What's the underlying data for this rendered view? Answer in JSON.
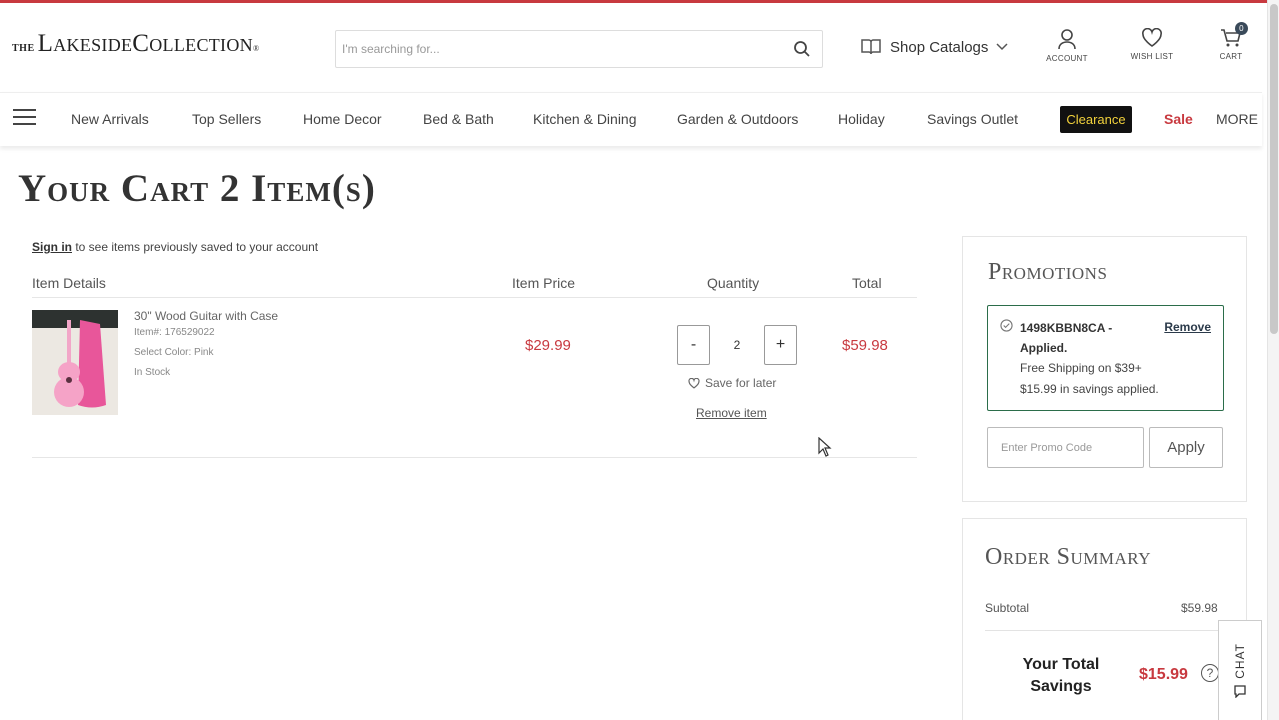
{
  "header": {
    "logo": {
      "the": "THE",
      "name": "LakesideCollection",
      "reg": "®"
    },
    "search": {
      "placeholder": "I'm searching for..."
    },
    "catalogs_label": "Shop Catalogs",
    "account_label": "ACCOUNT",
    "wishlist_label": "WISH LIST",
    "cart_label": "CART",
    "cart_count": "0"
  },
  "nav": {
    "items": [
      "New Arrivals",
      "Top Sellers",
      "Home Decor",
      "Bed & Bath",
      "Kitchen & Dining",
      "Garden & Outdoors",
      "Holiday",
      "Savings Outlet"
    ],
    "clearance": "Clearance",
    "sale": "Sale",
    "more": "MORE"
  },
  "cart": {
    "title": "Your Cart 2 Item(s)",
    "signin_link": "Sign in",
    "signin_text": " to see items previously saved to your account",
    "headers": {
      "details": "Item Details",
      "price": "Item Price",
      "quantity": "Quantity",
      "total": "Total"
    },
    "item": {
      "name": "30\" Wood Guitar with Case",
      "item_number": "Item#: 176529022",
      "color": "Select Color: Pink",
      "stock": "In Stock",
      "price": "$29.99",
      "quantity": "2",
      "total": "$59.98",
      "minus": "-",
      "plus": "+",
      "save_for_later": "Save for later",
      "remove": "Remove item"
    }
  },
  "promotions": {
    "title": "Promotions",
    "code": "1498KBBN8CA - Applied.",
    "remove": "Remove",
    "detail1": "Free Shipping on $39+",
    "detail2": "$15.99 in savings applied.",
    "input_placeholder": "Enter Promo Code",
    "apply": "Apply"
  },
  "summary": {
    "title": "Order Summary",
    "subtotal_label": "Subtotal",
    "subtotal": "$59.98",
    "savings_label": "Your Total Savings",
    "savings": "$15.99",
    "help": "?"
  },
  "chat": {
    "label": "CHAT"
  },
  "colors": {
    "accent_red": "#c8393f",
    "promo_green": "#2b6d4a",
    "clearance_yellow": "#f2d23c"
  }
}
